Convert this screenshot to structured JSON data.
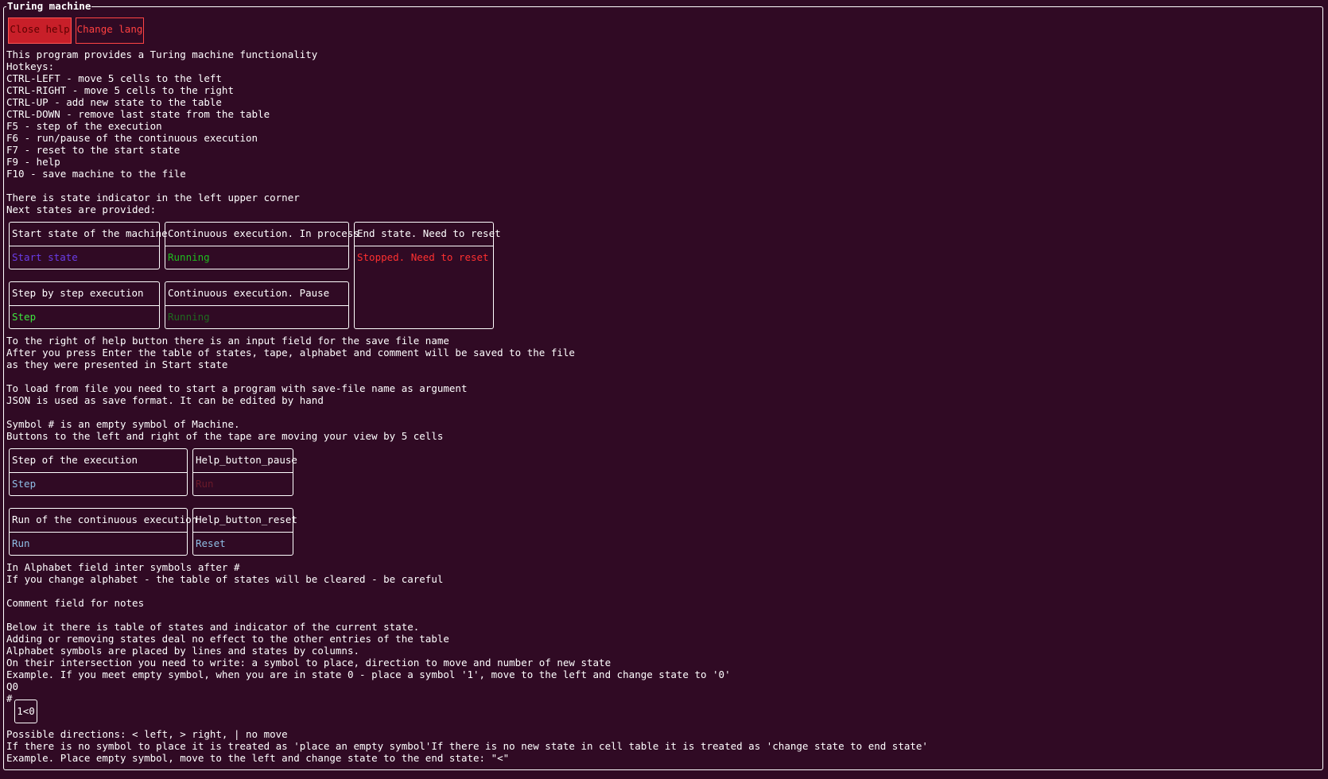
{
  "window": {
    "title": "Turing machine"
  },
  "toolbar": {
    "close_help": "Close help",
    "change_lang": "Change lang"
  },
  "help": {
    "intro": [
      "This program provides a Turing machine functionality",
      "Hotkeys:",
      "CTRL-LEFT - move 5 cells to the left",
      "CTRL-RIGHT - move 5 cells to the right",
      "CTRL-UP - add new state to the table",
      "CTRL-DOWN - remove last state from the table",
      "F5 - step of the execution",
      "F6 - run/pause of the continuous execution",
      "F7 - reset to the start state",
      "F9 - help",
      "F10 - save machine to the file",
      "",
      "There is state indicator in the left upper corner",
      "Next states are provided:"
    ],
    "states": [
      {
        "title": "Start state of the machine",
        "value": "Start state"
      },
      {
        "title": "Continuous execution. In process",
        "value": "Running"
      },
      {
        "title": "End state. Need to reset",
        "value": "Stopped. Need to reset"
      },
      {
        "title": "Step by step execution",
        "value": "Step"
      },
      {
        "title": "Continuous execution. Pause",
        "value": "Running"
      }
    ],
    "save_text": [
      "To the right of help button there is an input field for the save file name",
      "After you press Enter the table of states, tape, alphabet and comment will be saved to the file",
      "as they were presented in Start state",
      "",
      "To load from file you need to start a program with save-file name as argument",
      "JSON is used as save format. It can be edited by hand",
      "",
      "Symbol # is an empty symbol of Machine.",
      "Buttons to the left and right of the tape are moving your view by 5 cells"
    ],
    "controls": [
      {
        "title": "Step of the execution",
        "value": "Step"
      },
      {
        "title": "Help_button_pause",
        "value": "Run"
      },
      {
        "title": "Run of the continuous execution",
        "value": "Run"
      },
      {
        "title": "Help_button_reset",
        "value": "Reset"
      }
    ],
    "table_text": [
      "In Alphabet field inter symbols after #",
      "If you change alphabet - the table of states will be cleared - be careful",
      "",
      "Comment field for notes",
      "",
      "Below it there is table of states and indicator of the current state.",
      "Adding or removing states deal no effect to the other entries of the table",
      "Alphabet symbols are placed by lines and states by columns.",
      "On their intersection you need to write: a symbol to place, direction to move and number of new state",
      "Example. If you meet empty symbol, when you are in state 0 - place a symbol '1', move to the left and change state to '0'",
      "Q0",
      "#"
    ],
    "example_cell": "1<0",
    "directions_text": [
      "Possible directions: < left, > right, | no move",
      "If there is no symbol to place it is treated as 'place an empty symbol'If there is no new state in cell table it is treated as 'change state to end state'",
      "Example. Place empty symbol, move to the left and change state to the end state: \"<\""
    ]
  },
  "colors": {
    "background": "#300a24",
    "start": "#6a3de8",
    "running": "#1fbf1f",
    "step": "#3ee63e",
    "paused": "#1f6a1f",
    "stopped": "#ff3030",
    "control": "#8fbfe6"
  }
}
